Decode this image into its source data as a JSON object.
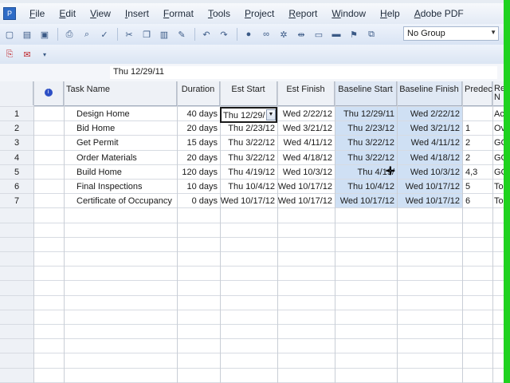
{
  "menu": [
    "File",
    "Edit",
    "View",
    "Insert",
    "Format",
    "Tools",
    "Project",
    "Report",
    "Window",
    "Help",
    "Adobe PDF"
  ],
  "toolbar": {
    "group_value": "No Group",
    "icons": [
      "new-icon",
      "open-icon",
      "save-icon",
      "print-icon",
      "print-preview-icon",
      "spelling-icon",
      "cut-icon",
      "copy-icon",
      "paste-icon",
      "format-painter-icon",
      "undo-icon",
      "redo-icon",
      "link-tasks-icon",
      "unlink-tasks-icon",
      "split-task-icon",
      "task-info-icon",
      "task-notes-icon",
      "assign-resources-icon",
      "publish-icon"
    ],
    "pdf_icons": [
      "convert-to-pdf-icon",
      "convert-and-email-icon"
    ]
  },
  "entry_bar": {
    "value": "Thu 12/29/11"
  },
  "grid": {
    "headers": {
      "indicators": "",
      "task_name": "Task Name",
      "duration": "Duration",
      "est_start": "Est Start",
      "est_finish": "Est Finish",
      "baseline_start": "Baseline Start",
      "baseline_finish": "Baseline Finish",
      "predecessors": "Predec",
      "resource_names": "Re N"
    },
    "rows": [
      {
        "id": "1",
        "name": "Design Home",
        "duration": "40 days",
        "est_start": "Thu 12/29/",
        "est_finish": "Wed 2/22/12",
        "baseline_start": "Thu 12/29/11",
        "baseline_finish": "Wed 2/22/12",
        "predecessors": "",
        "resource": "Ac"
      },
      {
        "id": "2",
        "name": "Bid Home",
        "duration": "20 days",
        "est_start": "Thu 2/23/12",
        "est_finish": "Wed 3/21/12",
        "baseline_start": "Thu 2/23/12",
        "baseline_finish": "Wed 3/21/12",
        "predecessors": "1",
        "resource": "Ov"
      },
      {
        "id": "3",
        "name": "Get Permit",
        "duration": "15 days",
        "est_start": "Thu 3/22/12",
        "est_finish": "Wed 4/11/12",
        "baseline_start": "Thu 3/22/12",
        "baseline_finish": "Wed 4/11/12",
        "predecessors": "2",
        "resource": "GC"
      },
      {
        "id": "4",
        "name": "Order Materials",
        "duration": "20 days",
        "est_start": "Thu 3/22/12",
        "est_finish": "Wed 4/18/12",
        "baseline_start": "Thu 3/22/12",
        "baseline_finish": "Wed 4/18/12",
        "predecessors": "2",
        "resource": "GC"
      },
      {
        "id": "5",
        "name": "Build Home",
        "duration": "120 days",
        "est_start": "Thu 4/19/12",
        "est_finish": "Wed 10/3/12",
        "baseline_start": "Thu 4/19/",
        "baseline_finish": "Wed 10/3/12",
        "predecessors": "4,3",
        "resource": "GC"
      },
      {
        "id": "6",
        "name": "Final Inspections",
        "duration": "10 days",
        "est_start": "Thu 10/4/12",
        "est_finish": "Wed 10/17/12",
        "baseline_start": "Thu 10/4/12",
        "baseline_finish": "Wed 10/17/12",
        "predecessors": "5",
        "resource": "To"
      },
      {
        "id": "7",
        "name": "Certificate of Occupancy",
        "duration": "0 days",
        "est_start": "Wed 10/17/12",
        "est_finish": "Wed 10/17/12",
        "baseline_start": "Wed 10/17/12",
        "baseline_finish": "Wed 10/17/12",
        "predecessors": "6",
        "resource": "To"
      }
    ]
  },
  "colors": {
    "selection_shade": "#cfe0f4",
    "window_border": "#1fd21f",
    "menu_bg": "#e3eaf5"
  }
}
